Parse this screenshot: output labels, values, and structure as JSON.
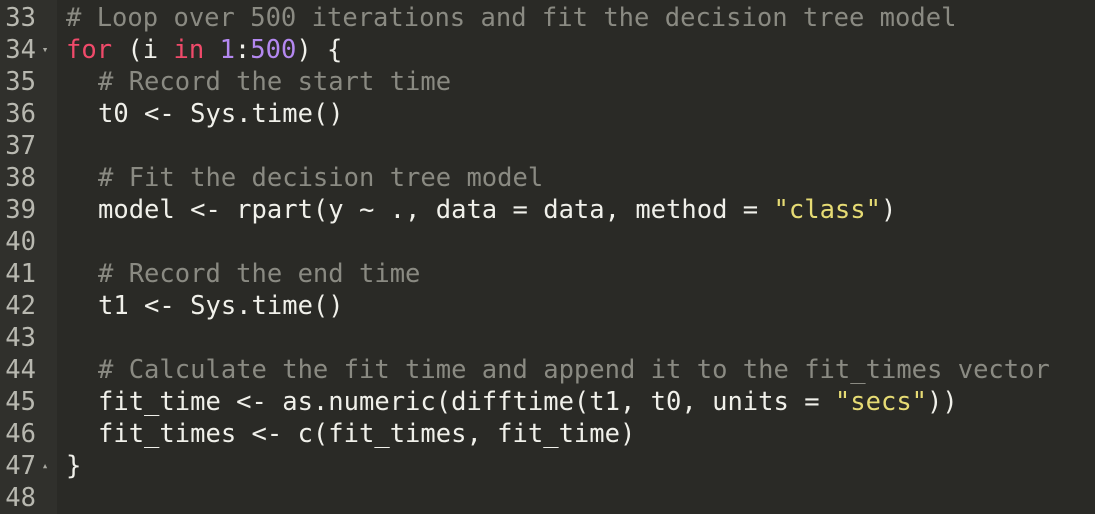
{
  "editor": {
    "colors": {
      "background": "#2a2a26",
      "gutter": "#30302c",
      "line_number": "#b8b8b0",
      "comment": "#8a8a82",
      "keyword": "#f04a6a",
      "number": "#b488f0",
      "string": "#e6db74",
      "text": "#f0f0ea"
    },
    "lines": [
      {
        "number": "33",
        "fold": "",
        "indent": 0,
        "tokens": [
          {
            "type": "comment",
            "text": "# Loop over 500 iterations and fit the decision tree model"
          }
        ]
      },
      {
        "number": "34",
        "fold": "▾",
        "fold_icon": "fold-collapse-icon",
        "indent": 0,
        "tokens": [
          {
            "type": "keyword",
            "text": "for"
          },
          {
            "type": "plain",
            "text": " (i "
          },
          {
            "type": "keyword",
            "text": "in"
          },
          {
            "type": "plain",
            "text": " "
          },
          {
            "type": "number",
            "text": "1"
          },
          {
            "type": "plain",
            "text": ":"
          },
          {
            "type": "number",
            "text": "500"
          },
          {
            "type": "plain",
            "text": ") {"
          }
        ]
      },
      {
        "number": "35",
        "fold": "",
        "indent": 1,
        "tokens": [
          {
            "type": "comment",
            "text": "# Record the start time"
          }
        ]
      },
      {
        "number": "36",
        "fold": "",
        "indent": 1,
        "tokens": [
          {
            "type": "plain",
            "text": "t0 <- Sys.time()"
          }
        ]
      },
      {
        "number": "37",
        "fold": "",
        "indent": 1,
        "tokens": []
      },
      {
        "number": "38",
        "fold": "",
        "indent": 1,
        "tokens": [
          {
            "type": "comment",
            "text": "# Fit the decision tree model"
          }
        ]
      },
      {
        "number": "39",
        "fold": "",
        "indent": 1,
        "tokens": [
          {
            "type": "plain",
            "text": "model <- rpart(y ~ ., data = data, method = "
          },
          {
            "type": "string",
            "text": "\"class\""
          },
          {
            "type": "plain",
            "text": ")"
          }
        ]
      },
      {
        "number": "40",
        "fold": "",
        "indent": 1,
        "tokens": []
      },
      {
        "number": "41",
        "fold": "",
        "indent": 1,
        "tokens": [
          {
            "type": "comment",
            "text": "# Record the end time"
          }
        ]
      },
      {
        "number": "42",
        "fold": "",
        "indent": 1,
        "tokens": [
          {
            "type": "plain",
            "text": "t1 <- Sys.time()"
          }
        ]
      },
      {
        "number": "43",
        "fold": "",
        "indent": 1,
        "tokens": []
      },
      {
        "number": "44",
        "fold": "",
        "indent": 1,
        "tokens": [
          {
            "type": "comment",
            "text": "# Calculate the fit time and append it to the fit_times vector"
          }
        ]
      },
      {
        "number": "45",
        "fold": "",
        "indent": 1,
        "tokens": [
          {
            "type": "plain",
            "text": "fit_time <- as.numeric(difftime(t1, t0, units = "
          },
          {
            "type": "string",
            "text": "\"secs\""
          },
          {
            "type": "plain",
            "text": "))"
          }
        ]
      },
      {
        "number": "46",
        "fold": "",
        "indent": 1,
        "tokens": [
          {
            "type": "plain",
            "text": "fit_times <- c(fit_times, fit_time)"
          }
        ]
      },
      {
        "number": "47",
        "fold": "▴",
        "fold_icon": "fold-expand-icon",
        "indent": 0,
        "tokens": [
          {
            "type": "plain",
            "text": "}"
          }
        ]
      },
      {
        "number": "48",
        "fold": "",
        "indent": 0,
        "tokens": []
      }
    ]
  }
}
